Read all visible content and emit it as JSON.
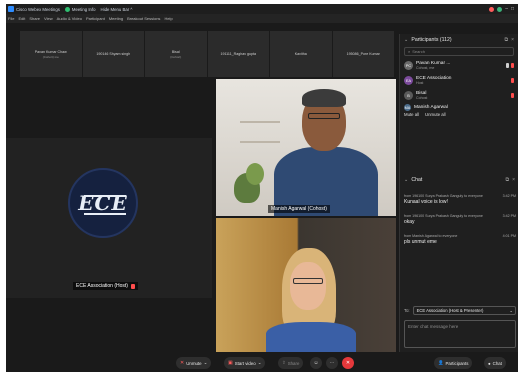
{
  "titlebar": {
    "app_title": "Cisco Webex Meetings",
    "meeting_info": "Meeting Info",
    "hide_menu": "Hide Menu Bar ^"
  },
  "menubar": [
    "File",
    "Edit",
    "Share",
    "View",
    "Audio & Video",
    "Participant",
    "Meeting",
    "Breakout Sessions",
    "Help"
  ],
  "thumbnails": [
    {
      "name": "Pavan Kumar Chaw",
      "sub": "(Cohort) me"
    },
    {
      "name": "190146 Shyam singh",
      "sub": ""
    },
    {
      "name": "Bisal",
      "sub": "(Cohort)"
    },
    {
      "name": "191111_Raghav gupta",
      "sub": ""
    },
    {
      "name": "Kavitha",
      "sub": ""
    },
    {
      "name": "195086_Pore Kumar",
      "sub": ""
    }
  ],
  "tiles": {
    "ece_logo_text": "ECE",
    "ece_label": "ECE Association (Host)",
    "manish_label": "Manish Agarwal (Cohost)"
  },
  "participants": {
    "header": "Participants (112)",
    "search_placeholder": "Search",
    "items": [
      {
        "initials": "PC",
        "name": "Pavan Kumar ...",
        "sub": "Cohost, me"
      },
      {
        "initials": "EA",
        "name": "ECE Association",
        "sub": "Host"
      },
      {
        "initials": "B",
        "name": "Bisal",
        "sub": "Cohost"
      },
      {
        "initials": "MA",
        "name": "Manish Agarwal",
        "sub": ""
      }
    ],
    "mute_all": "Mute all",
    "unmute_all": "Unmute all"
  },
  "chat": {
    "header": "Chat",
    "messages": [
      {
        "from": "from 196100 Surya Prakash Ganguly to everyone",
        "time": "3:42 PM",
        "text": "Kunaal voice is low!"
      },
      {
        "from": "from 196100 Surya Prakash Ganguly to everyone",
        "time": "3:42 PM",
        "text": "okay"
      },
      {
        "from": "from Manish Agarwal to everyone",
        "time": "4:01 PM",
        "text": "pls unmut eme"
      }
    ],
    "to_label": "To:",
    "to_value": "ECE Association (Host & Presenter)",
    "input_placeholder": "Enter chat message here"
  },
  "toolbar": {
    "unmute": "Unmute",
    "start_video": "Start video",
    "share": "Share",
    "participants": "Participants",
    "chat": "Chat"
  },
  "colors": {
    "accent": "#2d8cff",
    "danger": "#e5383b",
    "background": "#1a1a1a"
  }
}
